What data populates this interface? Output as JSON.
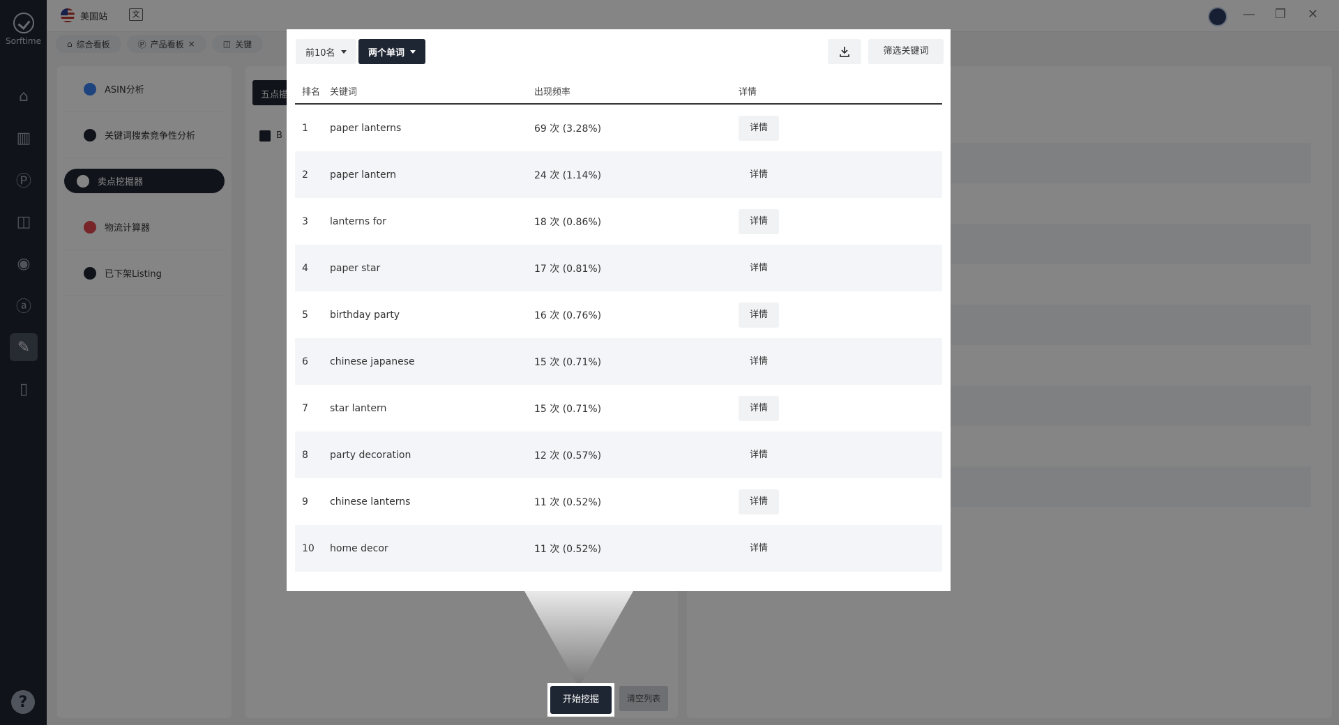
{
  "app": {
    "brand": "Sorftime"
  },
  "topbar": {
    "site_label": "美国站",
    "translate_glyph": "文"
  },
  "window_controls": {
    "minimize": "—",
    "restore": "❐",
    "close": "✕"
  },
  "tabs": [
    {
      "label": "综合看板",
      "icon": "home-icon"
    },
    {
      "label": "产品看板",
      "icon": "p-icon",
      "close": "×"
    },
    {
      "label": "关键",
      "icon": "ab-icon"
    }
  ],
  "features": [
    {
      "label": "ASIN分析",
      "color": "#3b82f6"
    },
    {
      "label": "关键词搜索竞争性分析",
      "color": "#1f2633"
    },
    {
      "label": "卖点挖掘器",
      "color": "#ffffff"
    },
    {
      "label": "物流计算器",
      "color": "#e5484d"
    },
    {
      "label": "已下架Listing",
      "color": "#1f2633"
    }
  ],
  "mid_panel": {
    "tab_label": "五点描",
    "checkbox_label": "B"
  },
  "bottom": {
    "start_label": "开始挖掘",
    "clear_label": "清空列表"
  },
  "modal": {
    "top_n_label": "前10名",
    "word_mode_label": "两个单词",
    "filter_label": "筛选关键词",
    "columns": {
      "rank": "排名",
      "keyword": "关键词",
      "frequency": "出现频率",
      "detail": "详情"
    },
    "rows": [
      {
        "rank": "1",
        "keyword": "paper lanterns",
        "frequency": "69 次 (3.28%)",
        "detail": "详情"
      },
      {
        "rank": "2",
        "keyword": "paper lantern",
        "frequency": "24 次 (1.14%)",
        "detail": "详情"
      },
      {
        "rank": "3",
        "keyword": "lanterns for",
        "frequency": "18 次 (0.86%)",
        "detail": "详情"
      },
      {
        "rank": "4",
        "keyword": "paper star",
        "frequency": "17 次 (0.81%)",
        "detail": "详情"
      },
      {
        "rank": "5",
        "keyword": "birthday party",
        "frequency": "16 次 (0.76%)",
        "detail": "详情"
      },
      {
        "rank": "6",
        "keyword": "chinese japanese",
        "frequency": "15 次 (0.71%)",
        "detail": "详情"
      },
      {
        "rank": "7",
        "keyword": "star lantern",
        "frequency": "15 次 (0.71%)",
        "detail": "详情"
      },
      {
        "rank": "8",
        "keyword": "party decoration",
        "frequency": "12 次 (0.57%)",
        "detail": "详情"
      },
      {
        "rank": "9",
        "keyword": "chinese lanterns",
        "frequency": "11 次 (0.52%)",
        "detail": "详情"
      },
      {
        "rank": "10",
        "keyword": "home decor",
        "frequency": "11 次 (0.52%)",
        "detail": "详情"
      }
    ]
  }
}
